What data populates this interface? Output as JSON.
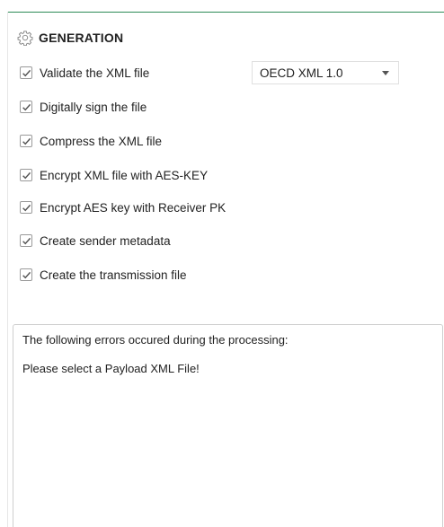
{
  "section": {
    "title": "GENERATION",
    "icon": "gear-icon"
  },
  "options": [
    {
      "label": "Validate the XML file",
      "checked": true
    },
    {
      "label": "Digitally sign the file",
      "checked": true
    },
    {
      "label": "Compress the XML file",
      "checked": true
    },
    {
      "label": "Encrypt XML file with AES-KEY",
      "checked": true
    },
    {
      "label": "Encrypt AES key with Receiver PK",
      "checked": true
    },
    {
      "label": "Create sender metadata",
      "checked": true
    },
    {
      "label": "Create the transmission file",
      "checked": true
    }
  ],
  "format_select": {
    "value": "OECD XML 1.0"
  },
  "log": {
    "lines": [
      "The following errors occured during the processing:",
      "Please select a Payload XML File!"
    ]
  },
  "colors": {
    "accent_line": "#2e8b57",
    "checkmark": "#555555",
    "border": "#cfcfcf"
  }
}
